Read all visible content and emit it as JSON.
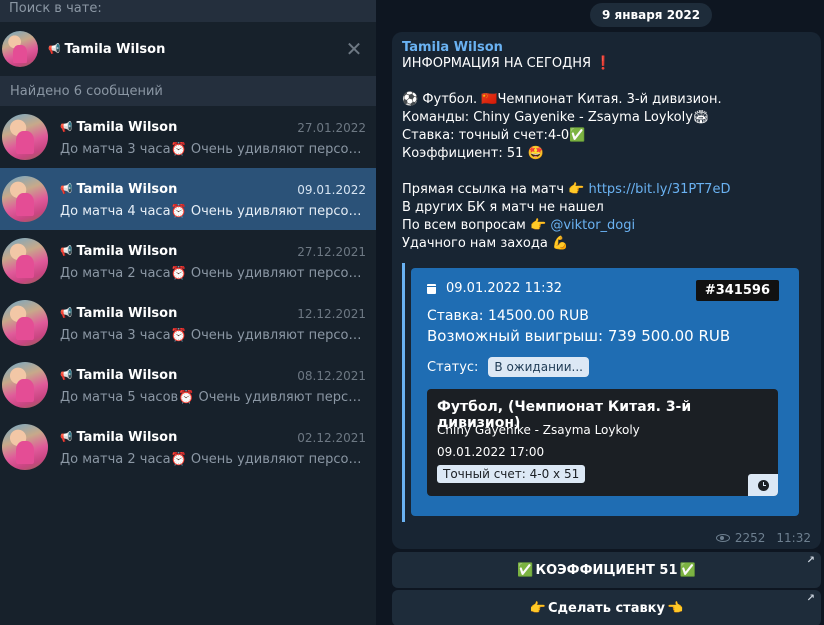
{
  "search": {
    "placeholder": "Поиск в чате:"
  },
  "filter": {
    "name": "Tamila Wilson"
  },
  "found_text": "Найдено 6 сообщений",
  "results": [
    {
      "name": "Tamila Wilson",
      "date": "27.01.2022",
      "preview_a": "До матча 3 часа",
      "preview_b": " Очень удивляют персонаж..."
    },
    {
      "name": "Tamila Wilson",
      "date": "09.01.2022",
      "preview_a": "До матча 4 часа",
      "preview_b": " Очень удивляют персонаж..."
    },
    {
      "name": "Tamila Wilson",
      "date": "27.12.2021",
      "preview_a": "До матча 2 часа",
      "preview_b": " Очень удивляют персонаж..."
    },
    {
      "name": "Tamila Wilson",
      "date": "12.12.2021",
      "preview_a": "До матча 3 часа",
      "preview_b": " Очень удивляют персонаж..."
    },
    {
      "name": "Tamila Wilson",
      "date": "08.12.2021",
      "preview_a": "До матча 5 часов",
      "preview_b": " Очень удивляют персона..."
    },
    {
      "name": "Tamila Wilson",
      "date": "02.12.2021",
      "preview_a": "До матча 2 часа",
      "preview_b": " Очень удивляют персонаж..."
    }
  ],
  "chat": {
    "date_pill": "9 января 2022",
    "sender": "Tamila Wilson",
    "lines": {
      "l1": "ИНФОРМАЦИЯ НА СЕГОДНЯ ",
      "l2": " Футбол. ",
      "l2b": "Чемпионат Китая. 3-й дивизион.",
      "l3": "Команды: Chiny Gayenike - Zsayma Loykoly",
      "l4": "Ставка: точный счет:4-0",
      "l5": "Коэффициент: 51",
      "l6": "Прямая ссылка на матч  ",
      "l6link": "https://bit.ly/31PT7eD",
      "l7": "В других БК я матч не нашел",
      "l8": "По всем вопросам ",
      "l8link": "@viktor_dogi",
      "l9": "Удачного нам захода "
    },
    "emoji": {
      "excl": "❗",
      "ball": "⚽",
      "flag": "🇨🇳",
      "stadium": "🏟",
      "check": "✅",
      "star_eyes": "🤩",
      "point_right": "👉",
      "muscle": "💪",
      "alarm": "⏰",
      "point_left": "👈"
    },
    "preview": {
      "date": "09.01.2022 11:32",
      "ticket": "#341596",
      "stake": "Ставка: 14500.00 RUB",
      "win": "Возможный выигрыш: 739 500.00 RUB",
      "status_label": "Статус:",
      "status_value": "В ожидании...",
      "card_title": "Футбол, (Чемпионат Китая. 3-й дивизион)",
      "card_teams": "Chiny Gayenike - Zsayma Loykoly",
      "card_date": "09.01.2022 17:00",
      "card_bet": "Точный счет: 4-0   x 51"
    },
    "views": "2252",
    "time": "11:32",
    "buttons": {
      "coef": "КОЭФФИЦИЕНТ 51",
      "bet": "Сделать ставку"
    }
  }
}
